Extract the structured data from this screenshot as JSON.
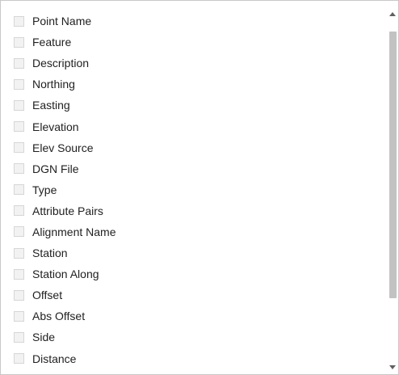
{
  "list": {
    "items": [
      {
        "label": "Point Name",
        "checked": false
      },
      {
        "label": "Feature",
        "checked": false
      },
      {
        "label": "Description",
        "checked": false
      },
      {
        "label": "Northing",
        "checked": false
      },
      {
        "label": "Easting",
        "checked": false
      },
      {
        "label": "Elevation",
        "checked": false
      },
      {
        "label": "Elev Source",
        "checked": false
      },
      {
        "label": "DGN File",
        "checked": false
      },
      {
        "label": "Type",
        "checked": false
      },
      {
        "label": "Attribute Pairs",
        "checked": false
      },
      {
        "label": "Alignment Name",
        "checked": false
      },
      {
        "label": "Station",
        "checked": false
      },
      {
        "label": "Station Along",
        "checked": false
      },
      {
        "label": "Offset",
        "checked": false
      },
      {
        "label": "Abs Offset",
        "checked": false
      },
      {
        "label": "Side",
        "checked": false
      },
      {
        "label": "Distance",
        "checked": false
      }
    ]
  },
  "scrollbar": {
    "up_icon": "chevron-up-icon",
    "down_icon": "chevron-down-icon"
  },
  "colors": {
    "border": "#c8c8c8",
    "checkbox_fill": "#f2f2f2",
    "checkbox_border": "#d6d6d6",
    "text": "#1f1f1f",
    "scroll_thumb": "#c2c2c2",
    "scroll_arrow": "#606060"
  }
}
